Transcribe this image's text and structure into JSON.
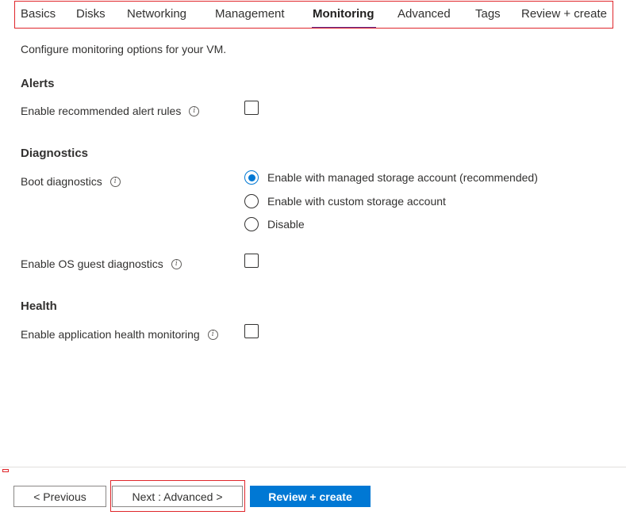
{
  "tabs": [
    {
      "label": "Basics"
    },
    {
      "label": "Disks"
    },
    {
      "label": "Networking"
    },
    {
      "label": "Management"
    },
    {
      "label": "Monitoring",
      "active": true
    },
    {
      "label": "Advanced"
    },
    {
      "label": "Tags"
    },
    {
      "label": "Review + create"
    }
  ],
  "intro": "Configure monitoring options for your VM.",
  "alerts": {
    "heading": "Alerts",
    "recommended_rules_label": "Enable recommended alert rules",
    "recommended_rules_checked": false
  },
  "diagnostics": {
    "heading": "Diagnostics",
    "boot_label": "Boot diagnostics",
    "boot_options": [
      {
        "label": "Enable with managed storage account (recommended)",
        "selected": true
      },
      {
        "label": "Enable with custom storage account",
        "selected": false
      },
      {
        "label": "Disable",
        "selected": false
      }
    ],
    "os_guest_label": "Enable OS guest diagnostics",
    "os_guest_checked": false
  },
  "health": {
    "heading": "Health",
    "app_health_label": "Enable application health monitoring",
    "app_health_checked": false
  },
  "footer": {
    "previous_label": "< Previous",
    "next_label": "Next : Advanced >",
    "review_label": "Review + create"
  },
  "colors": {
    "accent": "#0078d4",
    "tab_underline": "#5c2d91",
    "highlight": "#e0262b"
  },
  "icons": {
    "info": "info-icon"
  }
}
